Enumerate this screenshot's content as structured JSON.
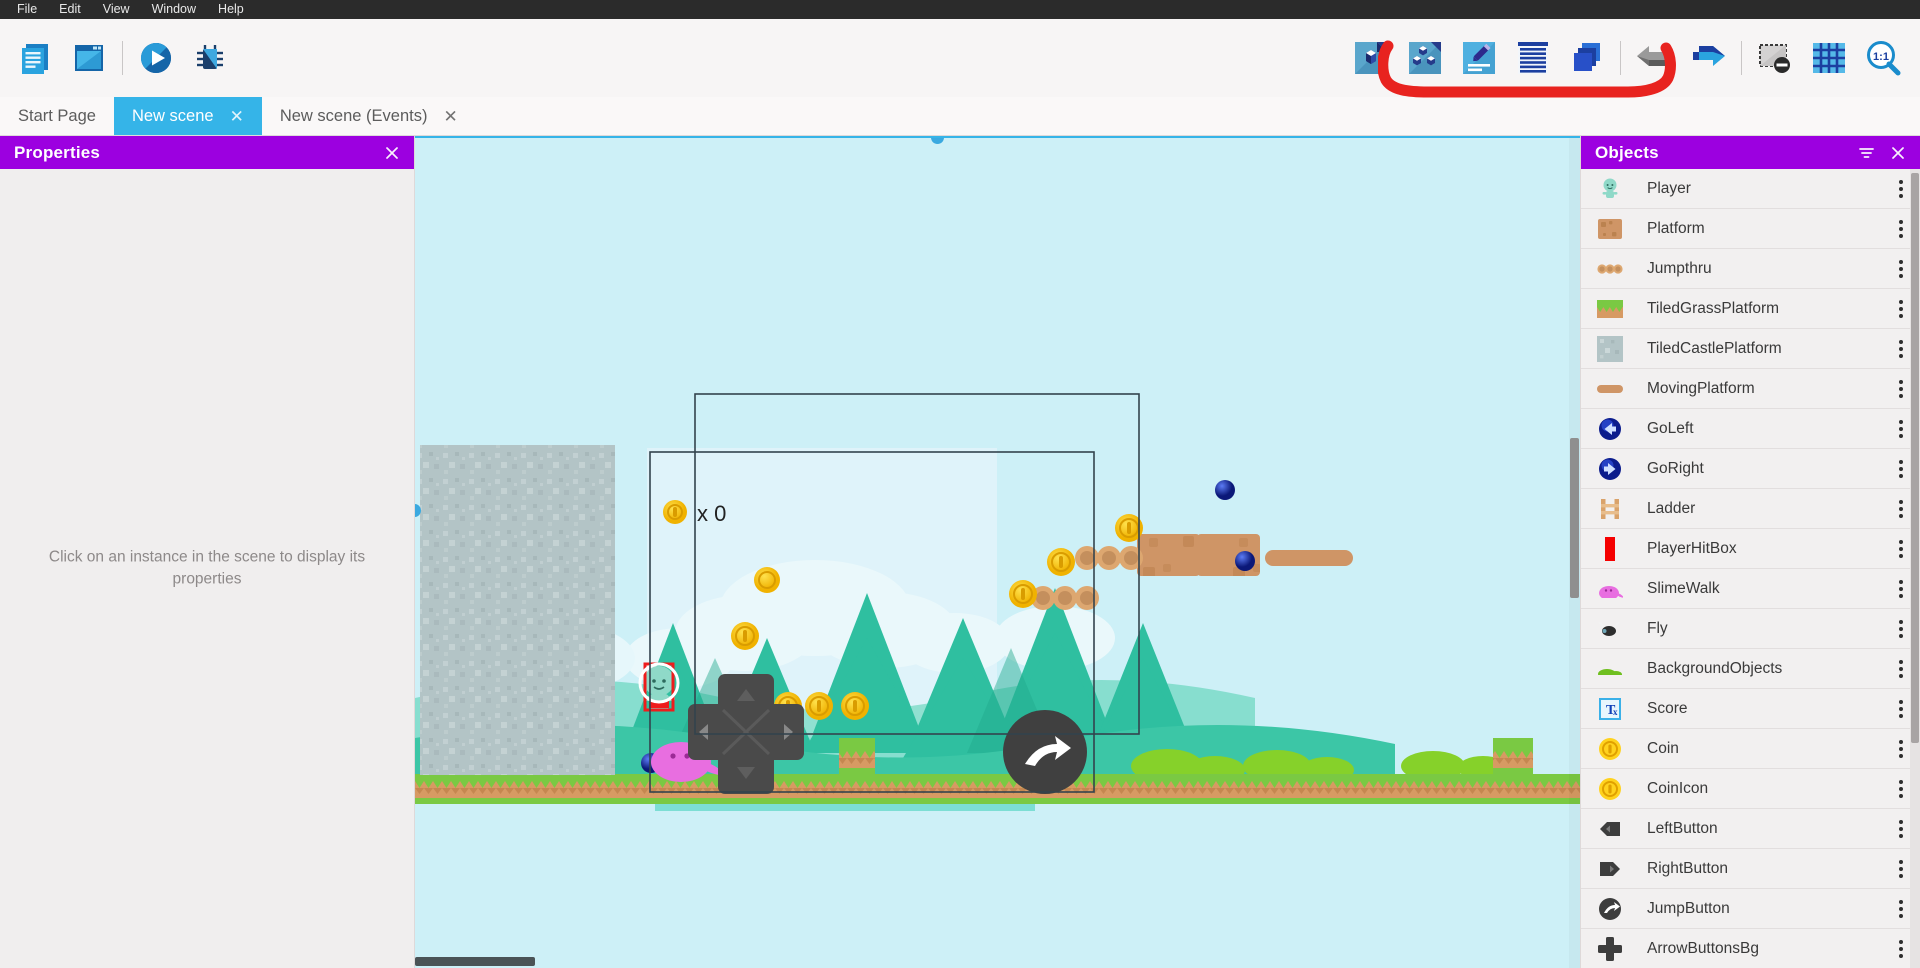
{
  "menubar": {
    "items": [
      {
        "label": "File",
        "name": "menu-file"
      },
      {
        "label": "Edit",
        "name": "menu-edit"
      },
      {
        "label": "View",
        "name": "menu-view"
      },
      {
        "label": "Window",
        "name": "menu-window"
      },
      {
        "label": "Help",
        "name": "menu-help"
      }
    ]
  },
  "toolbar": {
    "left": [
      {
        "name": "project-manager-icon",
        "title": "Open Project Manager"
      },
      {
        "name": "scene-editor-icon",
        "title": "Open Scene Editor"
      },
      {
        "name": "preview-play-icon",
        "title": "Launch a preview"
      },
      {
        "name": "debugger-icon",
        "title": "Launch preview with debugger"
      }
    ],
    "right": [
      {
        "name": "add-object-icon",
        "title": "Add a new object"
      },
      {
        "name": "objects-groups-icon",
        "title": "Edit object groups"
      },
      {
        "name": "edit-properties-icon",
        "title": "Edit scene properties"
      },
      {
        "name": "object-list-icon",
        "title": "Open objects list"
      },
      {
        "name": "layers-icon",
        "title": "Open layers list"
      },
      {
        "name": "undo-icon",
        "title": "Undo"
      },
      {
        "name": "redo-icon",
        "title": "Redo"
      },
      {
        "name": "hide-overlay-icon",
        "title": "Toggle instances rendering"
      },
      {
        "name": "grid-icon",
        "title": "Toggle grid"
      },
      {
        "name": "zoom-reset-icon",
        "title": "Reset zoom to 1:1"
      }
    ]
  },
  "tabs": [
    {
      "label": "Start Page",
      "active": false,
      "closable": false
    },
    {
      "label": "New scene",
      "active": true,
      "closable": true
    },
    {
      "label": "New scene (Events)",
      "active": false,
      "closable": true
    }
  ],
  "properties_panel": {
    "title": "Properties",
    "empty_message": "Click on an instance in the scene to display its properties",
    "close_label": "✕"
  },
  "objects_panel": {
    "title": "Objects",
    "filter_label": "filter-icon",
    "close_label": "✕",
    "items": [
      {
        "label": "Player",
        "thumb": "player"
      },
      {
        "label": "Platform",
        "thumb": "platform"
      },
      {
        "label": "Jumpthru",
        "thumb": "jumpthru"
      },
      {
        "label": "TiledGrassPlatform",
        "thumb": "grass"
      },
      {
        "label": "TiledCastlePlatform",
        "thumb": "castle"
      },
      {
        "label": "MovingPlatform",
        "thumb": "moving"
      },
      {
        "label": "GoLeft",
        "thumb": "goleft"
      },
      {
        "label": "GoRight",
        "thumb": "goright"
      },
      {
        "label": "Ladder",
        "thumb": "ladder"
      },
      {
        "label": "PlayerHitBox",
        "thumb": "hitbox"
      },
      {
        "label": "SlimeWalk",
        "thumb": "slime"
      },
      {
        "label": "Fly",
        "thumb": "fly"
      },
      {
        "label": "BackgroundObjects",
        "thumb": "bgobj"
      },
      {
        "label": "Score",
        "thumb": "text"
      },
      {
        "label": "Coin",
        "thumb": "coin"
      },
      {
        "label": "CoinIcon",
        "thumb": "coin"
      },
      {
        "label": "LeftButton",
        "thumb": "leftbtn"
      },
      {
        "label": "RightButton",
        "thumb": "rightbtn"
      },
      {
        "label": "JumpButton",
        "thumb": "jumpbtn"
      },
      {
        "label": "ArrowButtonsBg",
        "thumb": "arrowbg"
      }
    ]
  },
  "scene": {
    "score_text": "x 0",
    "name": "New scene",
    "colors": {
      "sky": "#cdf0f7",
      "panel_accent": "#9c00e0",
      "tab_active": "#35b4e8",
      "annotation": "#e8231f",
      "grass": "#7ac943",
      "dirt": "#d79a63"
    }
  },
  "annotation": {
    "shape": "red-bracket-underline",
    "color": "#e8231f"
  }
}
